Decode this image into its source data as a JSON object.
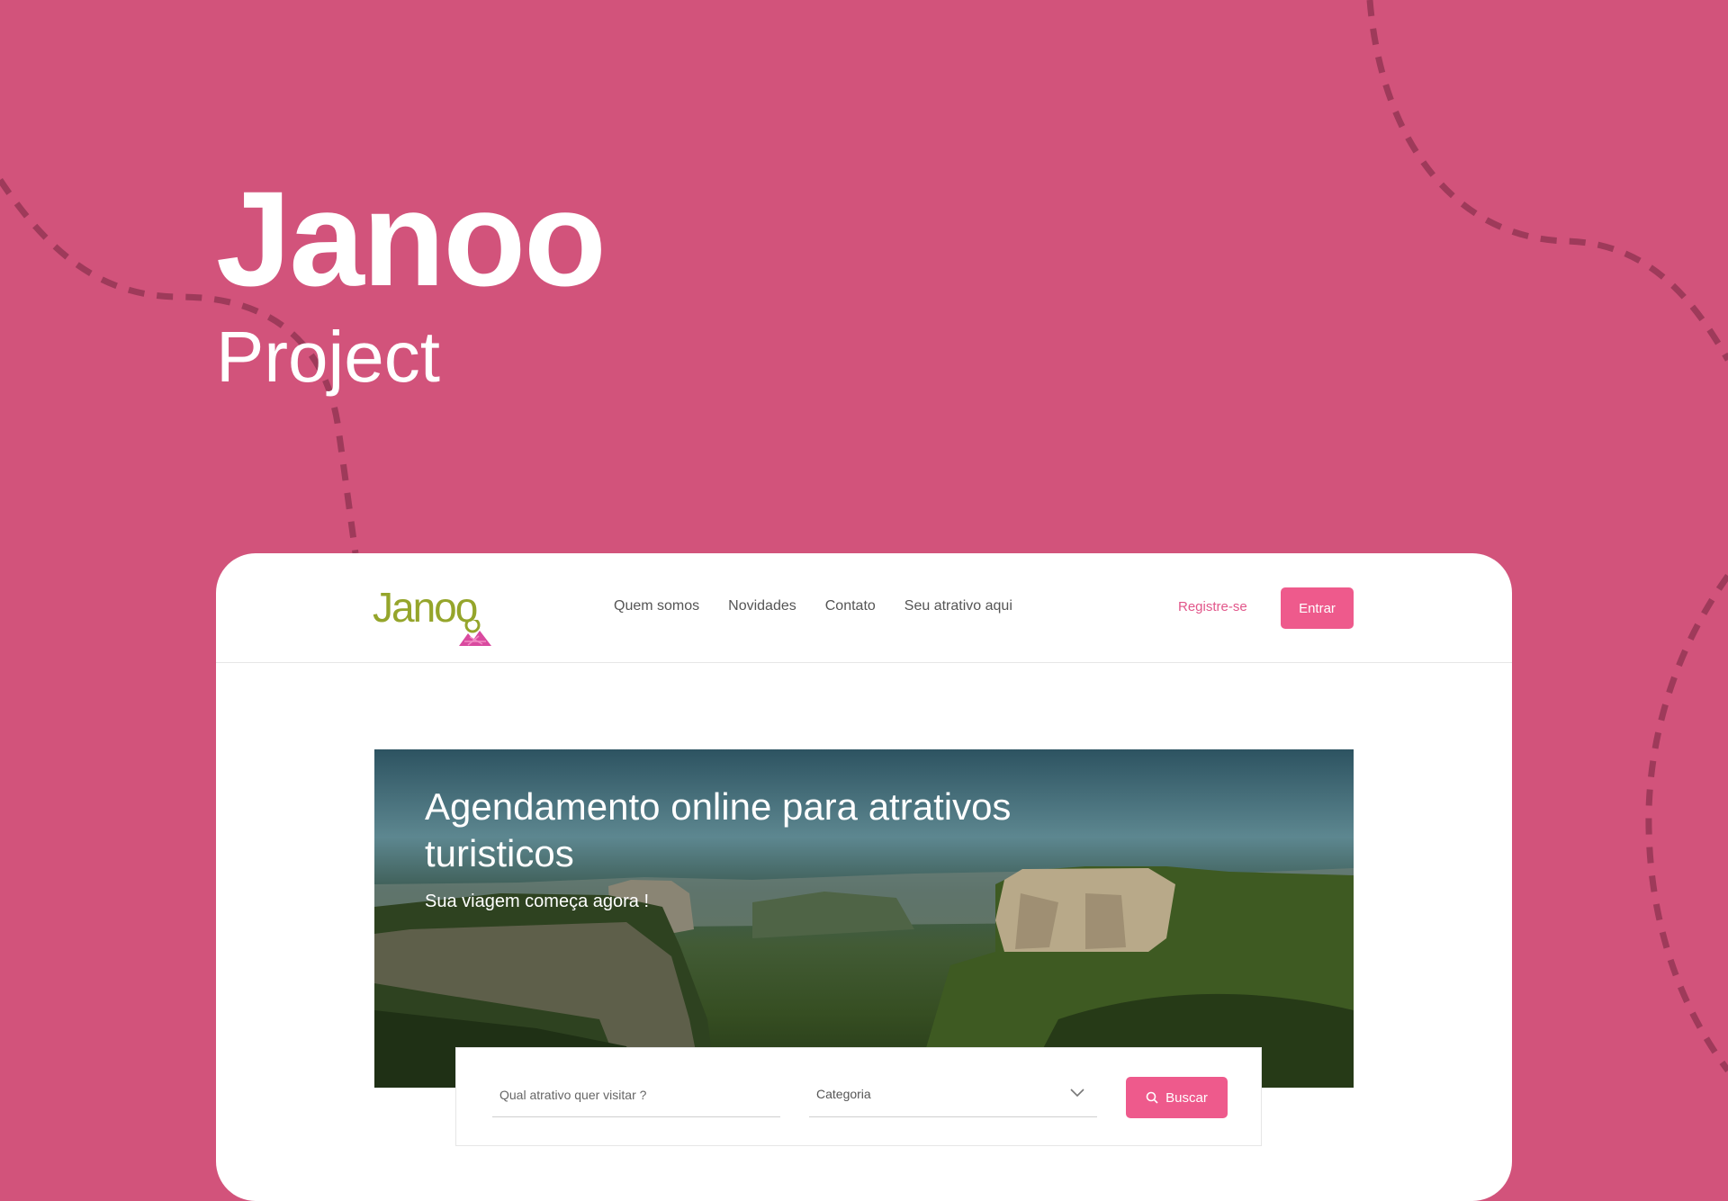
{
  "colors": {
    "background": "#d2537b",
    "accent": "#ee5a8c",
    "logo": "#95a52b"
  },
  "hero": {
    "title": "Janoo",
    "subtitle": "Project"
  },
  "nav": {
    "logo_text": "Janoo",
    "links": [
      "Quem somos",
      "Novidades",
      "Contato",
      "Seu atrativo aqui"
    ],
    "register_label": "Registre-se",
    "login_label": "Entrar"
  },
  "banner": {
    "title": "Agendamento online para atrativos turisticos",
    "subtitle": "Sua viagem começa agora !"
  },
  "search": {
    "placeholder": "Qual atrativo quer visitar ?",
    "category_label": "Categoria",
    "button_label": "Buscar",
    "icons": {
      "search": "search-icon",
      "chevron": "chevron-down-icon"
    }
  }
}
